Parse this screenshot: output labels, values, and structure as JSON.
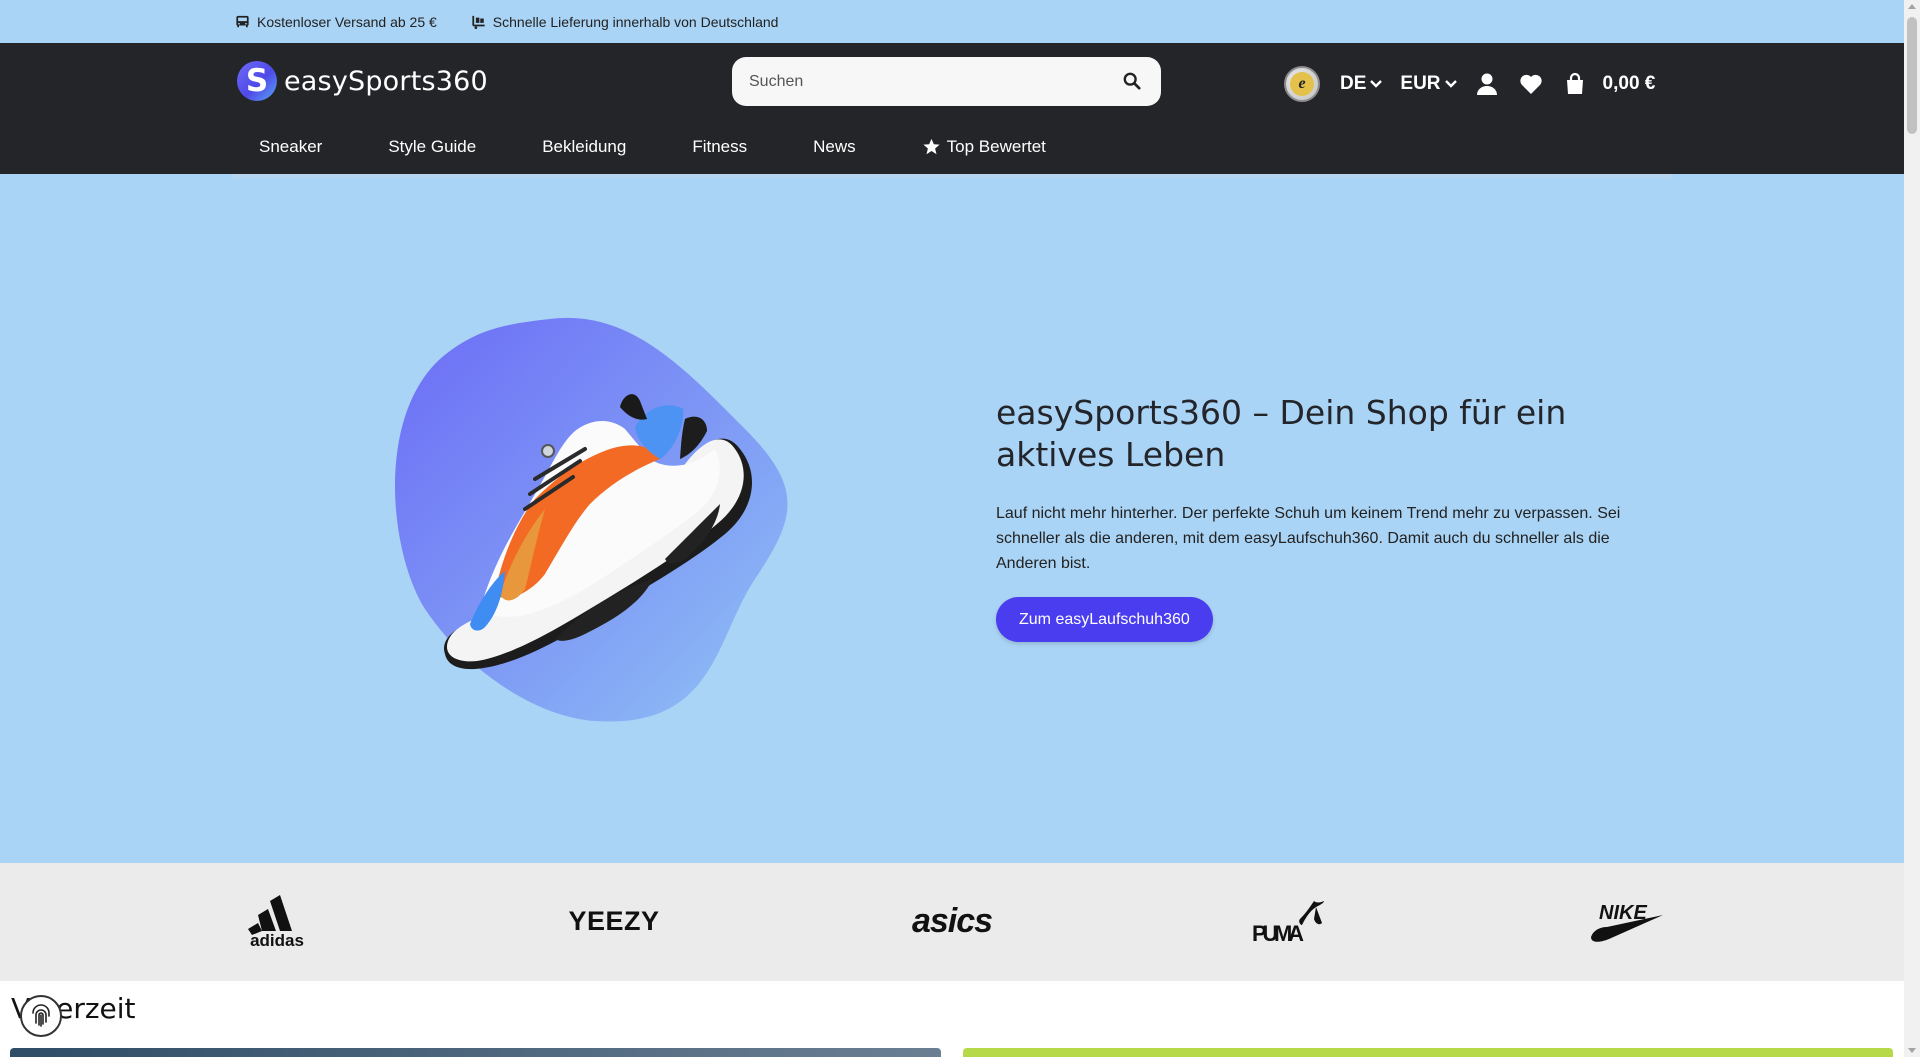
{
  "topbar": {
    "items": [
      {
        "icon": "bus-icon",
        "text": "Kostenloser Versand ab 25 €"
      },
      {
        "icon": "truck-loading-icon",
        "text": "Schnelle Lieferung innerhalb von Deutschland"
      }
    ]
  },
  "header": {
    "logo_text": "easySports360",
    "logo_mark": "S",
    "search_placeholder": "Suchen",
    "trust_badge": "e",
    "language": "DE",
    "currency": "EUR",
    "cart_total": "0,00 €"
  },
  "nav": {
    "items": [
      "Sneaker",
      "Style Guide",
      "Bekleidung",
      "Fitness",
      "News",
      "Top Bewertet"
    ]
  },
  "hero": {
    "title": "easySports360 – Dein Shop für ein aktives Leben",
    "body": "Lauf nicht mehr hinterher. Der perfekte Schuh um keinem Trend mehr zu verpassen. Sei schneller als die anderen, mit dem easyLaufschuh360. Damit auch du schneller als die Anderen bist.",
    "button": "Zum easyLaufschuh360"
  },
  "brands": [
    "adidas",
    "YEEZY",
    "asics",
    "PUMA",
    "NIKE"
  ],
  "section": {
    "title_partial": "terzeit"
  },
  "colors": {
    "accent": "#4a3df0",
    "hero_bg": "#aad4f5",
    "header_bg": "#242529",
    "brand_strip": "#ebebeb"
  }
}
